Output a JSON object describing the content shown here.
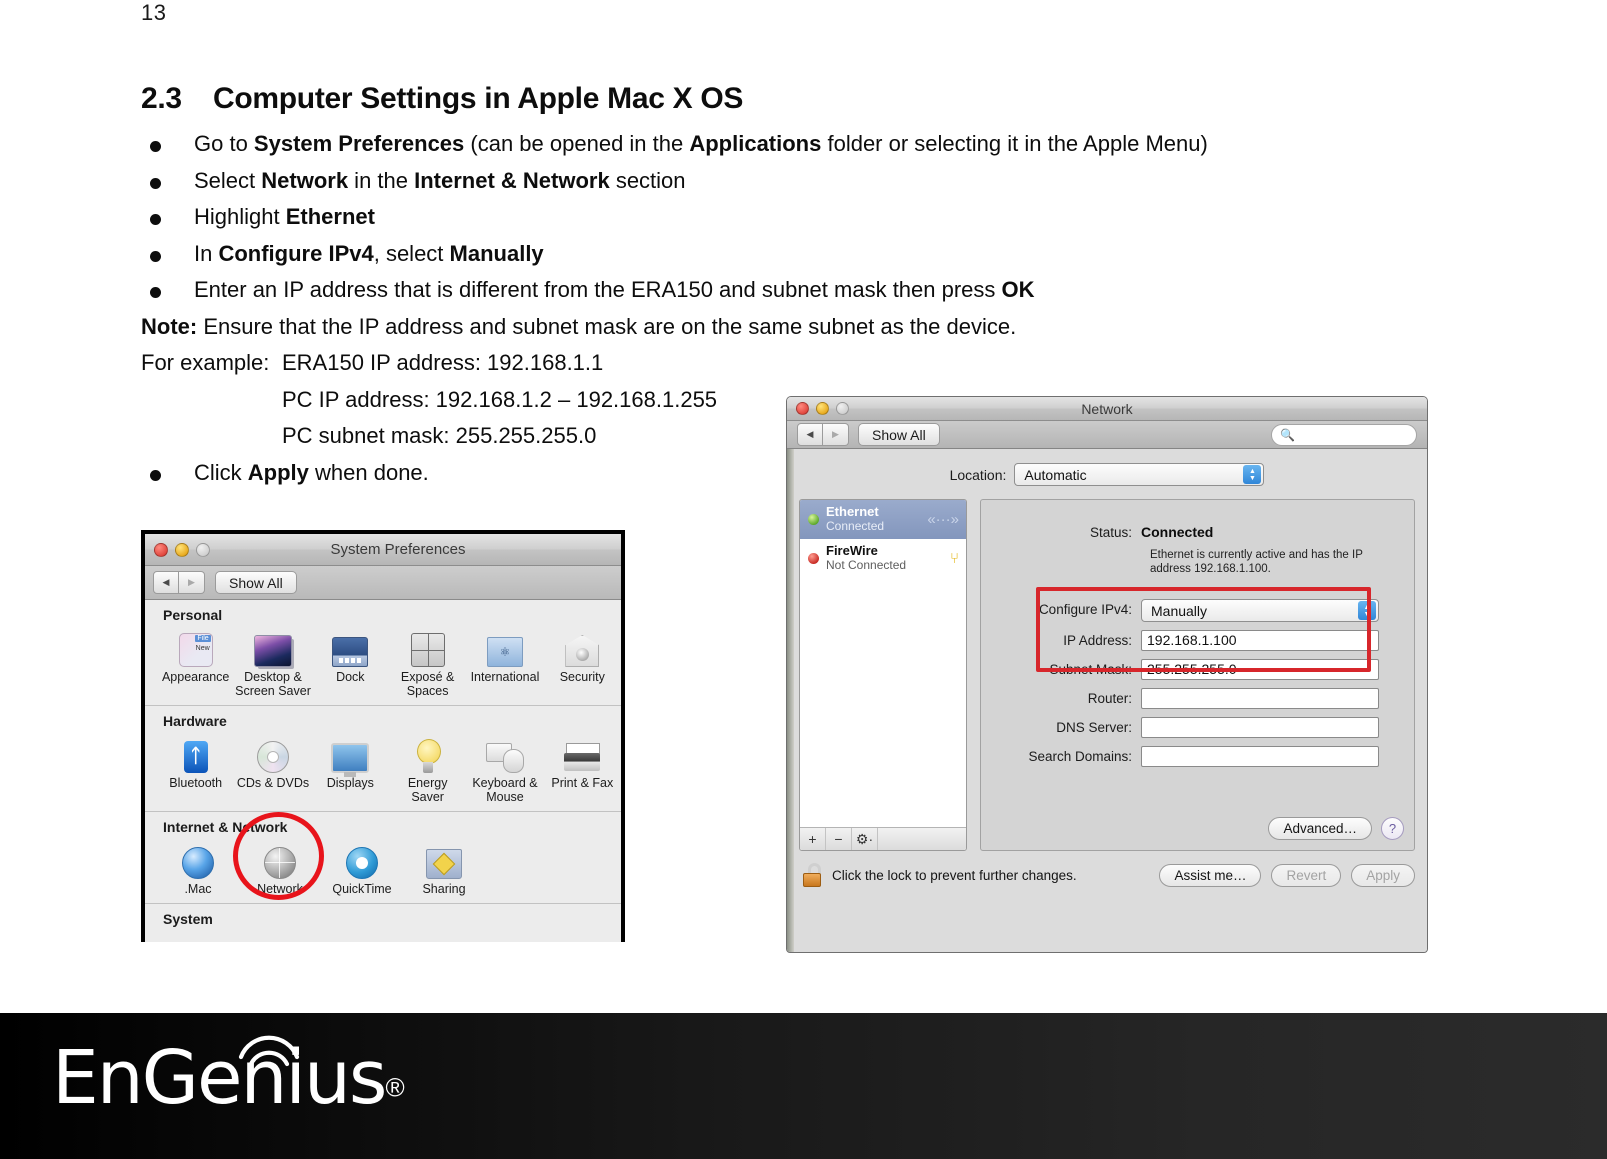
{
  "page": {
    "number": "13"
  },
  "section": {
    "number": "2.3",
    "title": "Computer Settings in Apple Mac X OS"
  },
  "instructions": [
    {
      "parts": [
        {
          "t": "Go to ",
          "b": false
        },
        {
          "t": "System Preferences",
          "b": true
        },
        {
          "t": " (can be opened in the ",
          "b": false
        },
        {
          "t": "Applications",
          "b": true
        },
        {
          "t": " folder or selecting it in the Apple Menu)",
          "b": false
        }
      ]
    },
    {
      "parts": [
        {
          "t": "Select ",
          "b": false
        },
        {
          "t": "Network",
          "b": true
        },
        {
          "t": " in the ",
          "b": false
        },
        {
          "t": "Internet & Network",
          "b": true
        },
        {
          "t": " section",
          "b": false
        }
      ]
    },
    {
      "parts": [
        {
          "t": "Highlight ",
          "b": false
        },
        {
          "t": "Ethernet",
          "b": true
        }
      ]
    },
    {
      "parts": [
        {
          "t": "In ",
          "b": false
        },
        {
          "t": "Configure IPv4",
          "b": true
        },
        {
          "t": ", select ",
          "b": false
        },
        {
          "t": "Manually",
          "b": true
        }
      ]
    },
    {
      "parts": [
        {
          "t": "Enter an IP address that is different from the ERA150 and subnet mask then press ",
          "b": false
        },
        {
          "t": "OK",
          "b": true
        }
      ]
    }
  ],
  "note": {
    "label": "Note:",
    "text": " Ensure that the IP address and subnet mask are on the same subnet as the device."
  },
  "example": {
    "label": "For example:",
    "lines": [
      "ERA150 IP address: 192.168.1.1",
      "PC IP address: 192.168.1.2 – 192.168.1.255",
      "PC subnet mask: 255.255.255.0"
    ]
  },
  "final_bullet": {
    "parts": [
      {
        "t": "Click ",
        "b": false
      },
      {
        "t": "Apply",
        "b": true
      },
      {
        "t": " when done.",
        "b": false
      }
    ]
  },
  "sysprefs": {
    "title": "System Preferences",
    "toolbar": {
      "back": "◀",
      "forward": "▶",
      "show_all": "Show All"
    },
    "groups": [
      {
        "title": "Personal",
        "items": [
          {
            "label": "Appearance",
            "icon": "appearance-icon"
          },
          {
            "label": "Desktop &\nScreen Saver",
            "icon": "desktop-screensaver-icon"
          },
          {
            "label": "Dock",
            "icon": "dock-icon"
          },
          {
            "label": "Exposé &\nSpaces",
            "icon": "expose-spaces-icon"
          },
          {
            "label": "International",
            "icon": "international-icon"
          },
          {
            "label": "Security",
            "icon": "security-icon"
          }
        ]
      },
      {
        "title": "Hardware",
        "items": [
          {
            "label": "Bluetooth",
            "icon": "bluetooth-icon"
          },
          {
            "label": "CDs & DVDs",
            "icon": "cd-dvd-icon"
          },
          {
            "label": "Displays",
            "icon": "displays-icon"
          },
          {
            "label": "Energy\nSaver",
            "icon": "energy-saver-icon"
          },
          {
            "label": "Keyboard &\nMouse",
            "icon": "keyboard-mouse-icon"
          },
          {
            "label": "Print & Fax",
            "icon": "print-fax-icon"
          }
        ]
      },
      {
        "title": "Internet & Network",
        "items": [
          {
            "label": ".Mac",
            "icon": "dot-mac-icon"
          },
          {
            "label": "Network",
            "icon": "network-icon"
          },
          {
            "label": "QuickTime",
            "icon": "quicktime-icon"
          },
          {
            "label": "Sharing",
            "icon": "sharing-icon"
          }
        ]
      },
      {
        "title": "System",
        "items": []
      }
    ]
  },
  "network": {
    "title": "Network",
    "toolbar": {
      "back": "◀",
      "forward": "▶",
      "show_all": "Show All",
      "search_placeholder": ""
    },
    "location": {
      "label": "Location:",
      "value": "Automatic"
    },
    "services": [
      {
        "name": "Ethernet",
        "state": "Connected",
        "led": "green",
        "glyph": "«···»",
        "selected": true
      },
      {
        "name": "FireWire",
        "state": "Not Connected",
        "led": "red",
        "glyph": "⑂",
        "selected": false
      }
    ],
    "list_footer": {
      "add": "+",
      "remove": "−",
      "action": "⚙·"
    },
    "status": {
      "label": "Status:",
      "value": "Connected",
      "description": "Ethernet is currently active and has the IP address 192.168.1.100."
    },
    "fields": [
      {
        "label": "Configure IPv4:",
        "value": "Manually",
        "type": "popup"
      },
      {
        "label": "IP Address:",
        "value": "192.168.1.100",
        "type": "text"
      },
      {
        "label": "Subnet Mask:",
        "value": "255.255.255.0",
        "type": "text"
      },
      {
        "label": "Router:",
        "value": "",
        "type": "text"
      },
      {
        "label": "DNS Server:",
        "value": "",
        "type": "text"
      },
      {
        "label": "Search Domains:",
        "value": "",
        "type": "text"
      }
    ],
    "advanced_button": "Advanced…",
    "help_button": "?",
    "lock_text": "Click the lock to prevent further changes.",
    "assist_button": "Assist me…",
    "revert_button": "Revert",
    "apply_button": "Apply"
  },
  "footer": {
    "brand": "EnGenius",
    "registered": "®"
  },
  "colors": {
    "highlight_red": "#d7262b",
    "annotation_red": "#e8141b",
    "selection_blue": "#8396bd",
    "stepper_blue": "#2f86d8"
  }
}
